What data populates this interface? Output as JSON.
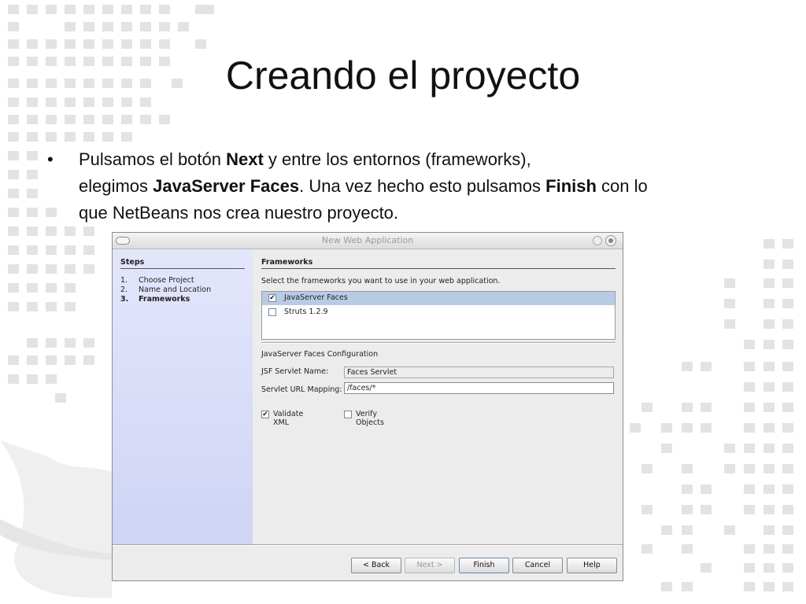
{
  "slide": {
    "title": "Creando el proyecto",
    "bullet_marker": "•",
    "bullet": {
      "t1": "Pulsamos el botón ",
      "b1": "Next",
      "t2": " y entre los entornos (frameworks),",
      "t3": "elegimos ",
      "b2": "JavaServer Faces",
      "t4": ". Una vez hecho esto pulsamos ",
      "b3": "Finish",
      "t5": " con lo",
      "t6": "que NetBeans nos crea nuestro proyecto."
    }
  },
  "dialog": {
    "title": "New Web Application",
    "steps": {
      "heading": "Steps",
      "items": [
        {
          "num": "1.",
          "label": "Choose Project"
        },
        {
          "num": "2.",
          "label": "Name and Location"
        },
        {
          "num": "3.",
          "label": "Frameworks"
        }
      ],
      "current_index": 2
    },
    "frameworks": {
      "heading": "Frameworks",
      "description": "Select the frameworks you want to use in your web application.",
      "list": [
        {
          "label": "JavaServer Faces",
          "checked": true,
          "selected": true
        },
        {
          "label": "Struts 1.2.9",
          "checked": false,
          "selected": false
        }
      ]
    },
    "config": {
      "heading": "JavaServer Faces Configuration",
      "servlet_name_label": "JSF Servlet Name:",
      "servlet_name_value": "Faces Servlet",
      "url_mapping_label": "Servlet URL Mapping:",
      "url_mapping_value": "/faces/*",
      "validate_xml_label": "Validate XML",
      "validate_xml_checked": true,
      "verify_objects_label": "Verify Objects",
      "verify_objects_checked": false
    },
    "buttons": {
      "back": "< Back",
      "next": "Next >",
      "finish": "Finish",
      "cancel": "Cancel",
      "help": "Help"
    }
  },
  "colors": {
    "steps_panel": "#d8dcf7",
    "selection": "#b8cbe4",
    "background_squares": "#e4e4e4"
  }
}
